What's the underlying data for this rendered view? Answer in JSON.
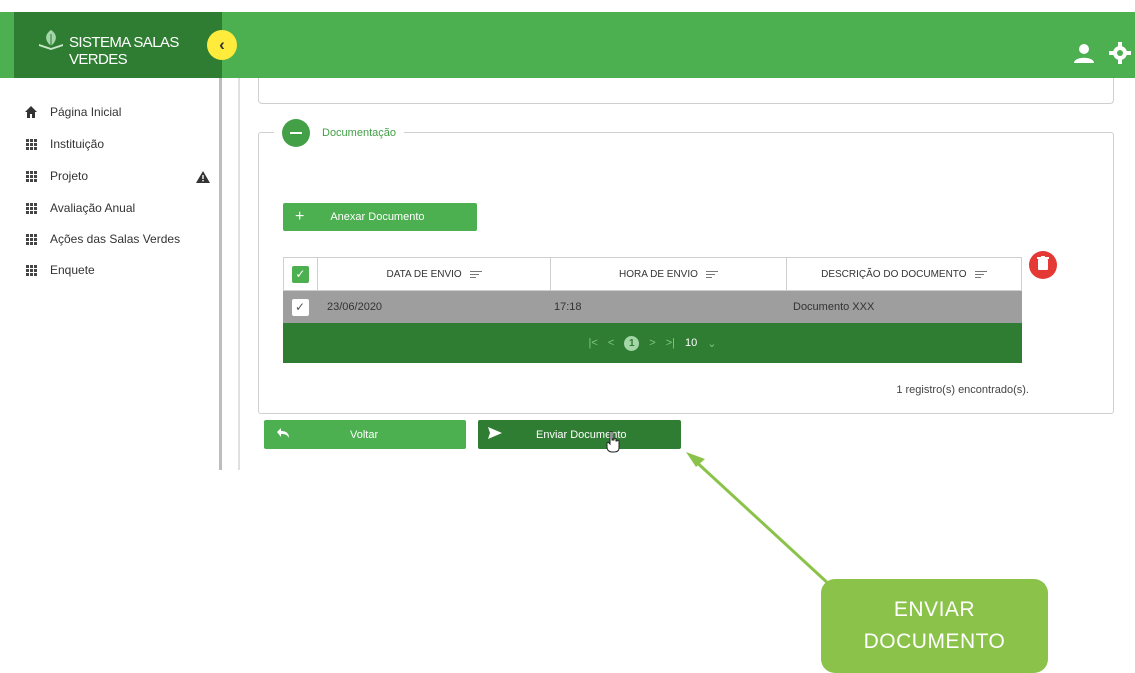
{
  "app": {
    "title": "SISTEMA SALAS VERDES",
    "colors": {
      "primary": "#4caf50",
      "primary_dark": "#2e7d32",
      "accent": "#ffeb3b",
      "danger": "#e53935",
      "callout": "#8bc34a"
    }
  },
  "header": {
    "collapse_icon": "chevron-left-icon",
    "icons": [
      "user-icon",
      "gear-icon"
    ]
  },
  "sidebar": {
    "items": [
      {
        "label": "Página Inicial",
        "icon": "home-icon"
      },
      {
        "label": "Instituição",
        "icon": "grid-icon"
      },
      {
        "label": "Projeto",
        "icon": "grid-icon",
        "warning": true
      },
      {
        "label": "Avaliação Anual",
        "icon": "grid-icon"
      },
      {
        "label": "Ações das Salas Verdes",
        "icon": "grid-icon"
      },
      {
        "label": "Enquete",
        "icon": "grid-icon"
      }
    ]
  },
  "section": {
    "title": "Documentação",
    "attach_label": "Anexar Documento"
  },
  "table": {
    "columns": [
      "DATA DE ENVIO",
      "HORA DE ENVIO",
      "DESCRIÇÃO DO DOCUMENTO"
    ],
    "rows": [
      {
        "date": "23/06/2020",
        "time": "17:18",
        "description": "Documento XXX",
        "checked": true
      }
    ],
    "pager": {
      "first": "|<",
      "prev": "<",
      "page": "1",
      "next": ">",
      "last": ">|",
      "page_size": "10"
    },
    "count_text": "1 registro(s) encontrado(s)."
  },
  "actions": {
    "back_label": "Voltar",
    "send_label": "Enviar Documento"
  },
  "callout": {
    "line1": "ENVIAR",
    "line2": "DOCUMENTO"
  }
}
